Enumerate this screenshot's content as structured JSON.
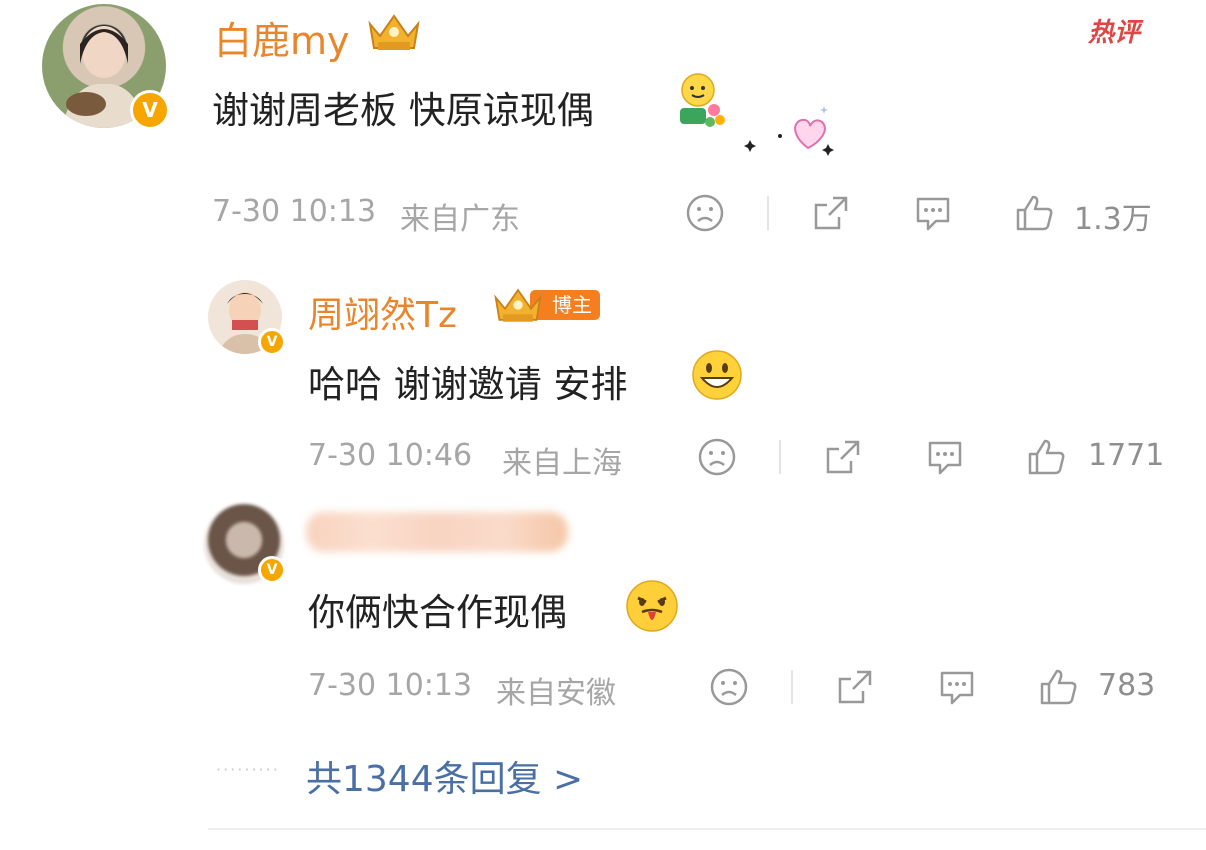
{
  "hot_label": "热评",
  "comments": [
    {
      "username": "白鹿my",
      "text": "谢谢周老板 快原谅现偶",
      "time": "7-30 10:13",
      "location": "来自广东",
      "likes": "1.3万",
      "verified_mark": "V"
    },
    {
      "username": "周翊然Tz",
      "tag": "博主",
      "text": "哈哈 谢谢邀请 安排",
      "time": "7-30 10:46",
      "location": "来自上海",
      "likes": "1771",
      "verified_mark": "V"
    },
    {
      "username": "",
      "text": "你俩快合作现偶",
      "time": "7-30 10:13",
      "location": "来自安徽",
      "likes": "783",
      "verified_mark": "V"
    }
  ],
  "replies_link": "共1344条回复 >",
  "icons": {
    "dislike": "sad-face-icon",
    "share": "share-icon",
    "comment": "comment-icon",
    "like": "thumbs-up-icon"
  },
  "colors": {
    "username": "#e9862b",
    "hot": "#e04545",
    "link": "#4a6fa5",
    "meta": "#a6a6a6",
    "badge": "#f7a600"
  }
}
